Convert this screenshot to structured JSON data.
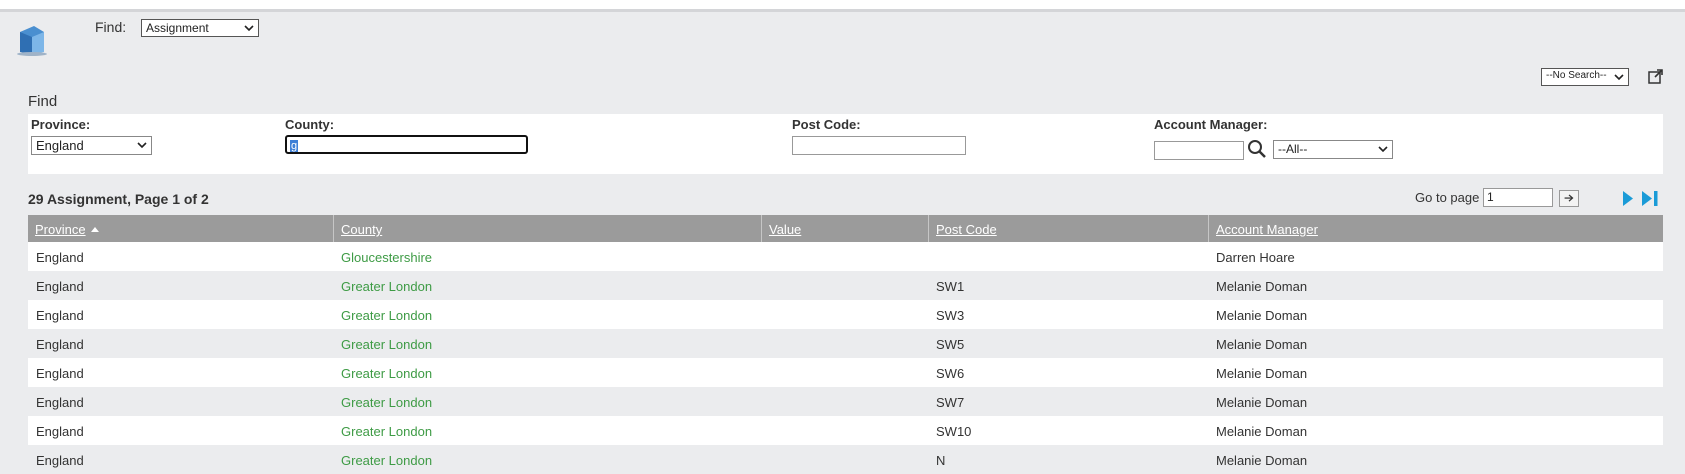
{
  "header": {
    "find_label": "Find:",
    "find_select_value": "Assignment",
    "saved_search_value": "--No Search--"
  },
  "filters": {
    "title": "Find",
    "province_label": "Province:",
    "province_value": "England",
    "county_label": "County:",
    "county_value": "g",
    "postcode_label": "Post Code:",
    "postcode_value": "",
    "account_manager_label": "Account Manager:",
    "account_manager_value": "",
    "account_manager_select_value": "--All--"
  },
  "results": {
    "summary": "29 Assignment, Page 1 of 2",
    "goto_label": "Go to page",
    "goto_value": "1"
  },
  "table": {
    "columns": [
      "Province",
      "County",
      "Value",
      "Post Code",
      "Account Manager"
    ],
    "sorted_column": "Province",
    "rows": [
      [
        "England",
        "Gloucestershire",
        "",
        "",
        "Darren Hoare"
      ],
      [
        "England",
        "Greater London",
        "",
        "SW1",
        "Melanie Doman"
      ],
      [
        "England",
        "Greater London",
        "",
        "SW3",
        "Melanie Doman"
      ],
      [
        "England",
        "Greater London",
        "",
        "SW5",
        "Melanie Doman"
      ],
      [
        "England",
        "Greater London",
        "",
        "SW6",
        "Melanie Doman"
      ],
      [
        "England",
        "Greater London",
        "",
        "SW7",
        "Melanie Doman"
      ],
      [
        "England",
        "Greater London",
        "",
        "SW10",
        "Melanie Doman"
      ],
      [
        "England",
        "Greater London",
        "",
        "N",
        "Melanie Doman"
      ]
    ]
  },
  "colors": {
    "link": "#3e9b45",
    "header_bg": "#9b9b9b",
    "page_bg": "#ebecee",
    "pager_accent": "#1a9bd7"
  },
  "icons": [
    "app-logo-icon",
    "export-icon",
    "search-icon",
    "next-page-icon",
    "last-page-icon",
    "go-arrow-icon"
  ]
}
